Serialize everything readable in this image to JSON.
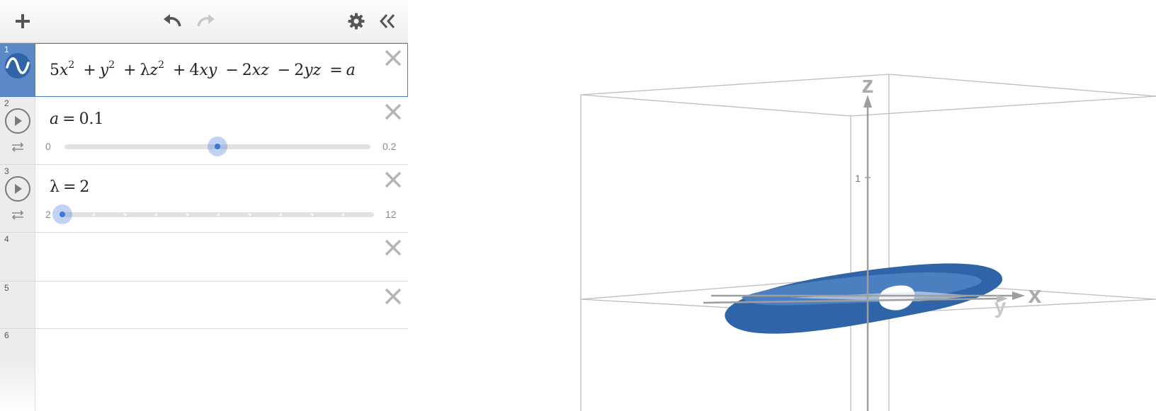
{
  "toolbar": {
    "add_icon": "plus-icon",
    "undo_icon": "undo-icon",
    "redo_icon": "redo-icon",
    "settings_icon": "gear-icon",
    "collapse_icon": "double-chevron-left-icon"
  },
  "expressions": [
    {
      "number": "1",
      "type": "surface",
      "icon": "wave-icon",
      "color": "#2f65a8",
      "formula": {
        "t1": "5",
        "v1": "x",
        "e1": "2",
        "plus1": "+",
        "v2": "y",
        "e2": "2",
        "plus2": "+",
        "c3": "λ",
        "v3": "z",
        "e3": "2",
        "plus3": "+",
        "c4": "4",
        "v4": "xy",
        "minus1": "−",
        "c5": "2",
        "v5": "xz",
        "minus2": "−",
        "c6": "2",
        "v6": "yz",
        "eq": "=",
        "rhs": "a"
      }
    },
    {
      "number": "2",
      "type": "slider",
      "var": "a",
      "eq": "=",
      "value": "0.1",
      "min": "0",
      "max": "0.2",
      "fraction": 0.5
    },
    {
      "number": "3",
      "type": "slider",
      "var": "λ",
      "eq": "=",
      "value": "2",
      "min": "2",
      "max": "12",
      "fraction": 0.0,
      "steps": 10
    },
    {
      "number": "4",
      "type": "empty"
    },
    {
      "number": "5",
      "type": "empty"
    },
    {
      "number": "6",
      "type": "empty"
    }
  ],
  "graph": {
    "axes": {
      "x": "x",
      "y": "y",
      "z": "z"
    },
    "z_tick": "1",
    "surface_color": "#2f65a8",
    "box_color": "#bdbdbd",
    "axis_color": "#9e9e9e"
  }
}
